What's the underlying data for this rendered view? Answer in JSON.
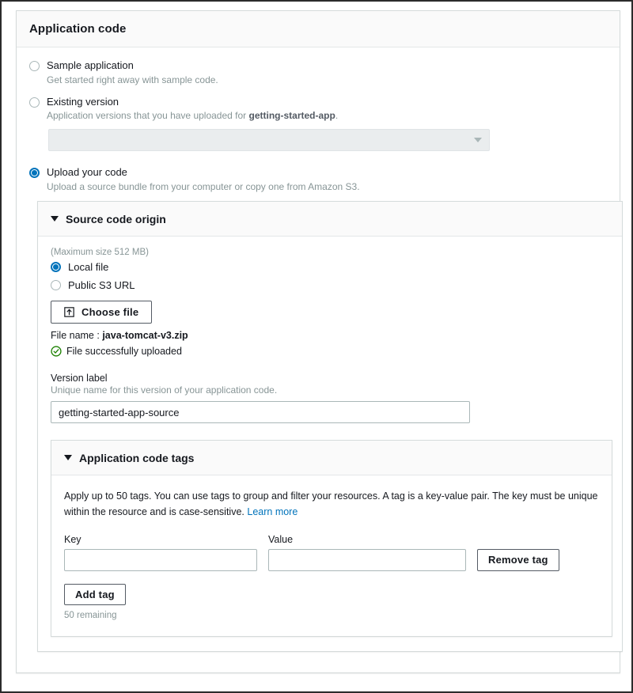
{
  "card": {
    "title": "Application code"
  },
  "code_options": [
    {
      "id": "sample-application",
      "label": "Sample application",
      "description": "Get started right away with sample code.",
      "selected": false
    },
    {
      "id": "existing-version",
      "label": "Existing version",
      "description_prefix": "Application versions that you have uploaded for ",
      "description_bold": "getting-started-app",
      "description_suffix": ".",
      "selected": false
    },
    {
      "id": "upload-your-code",
      "label": "Upload your code",
      "description": "Upload a source bundle from your computer or copy one from Amazon S3.",
      "selected": true
    }
  ],
  "version_select": {
    "value": "",
    "placeholder": "",
    "disabled": true,
    "icon": "chevron-down-icon"
  },
  "source_panel": {
    "title": "Source code origin",
    "twisty": "triangle-down-icon",
    "max_size_note": "(Maximum size 512 MB)",
    "origin_options": [
      {
        "id": "local-file",
        "label": "Local file",
        "selected": true
      },
      {
        "id": "public-s3-url",
        "label": "Public S3 URL",
        "selected": false
      }
    ],
    "choose_file_label": "Choose file",
    "choose_file_icon": "upload-icon",
    "file_name_prefix": "File name :",
    "file_name": "java-tomcat-v3.zip",
    "upload_status": "File successfully uploaded",
    "upload_status_icon": "check-circle-icon",
    "version_label": {
      "label": "Version label",
      "hint": "Unique name for this version of your application code.",
      "value": "getting-started-app-source",
      "placeholder": ""
    }
  },
  "tags_panel": {
    "title": "Application code tags",
    "twisty": "triangle-down-icon",
    "description": "Apply up to 50 tags. You can use tags to group and filter your resources. A tag is a key-value pair. The key must be unique within the resource and is case-sensitive. ",
    "learn_more": "Learn more",
    "key_label": "Key",
    "value_label": "Value",
    "key_value": "",
    "key_placeholder": "",
    "value_value": "",
    "value_placeholder": "",
    "remove_tag_label": "Remove tag",
    "add_tag_label": "Add tag",
    "remaining": "50 remaining"
  },
  "colors": {
    "accent": "#0073bb",
    "success": "#1d8102",
    "text": "#16191f",
    "muted": "#879596",
    "border": "#d5dbdb",
    "header_bg": "#fafafa"
  }
}
